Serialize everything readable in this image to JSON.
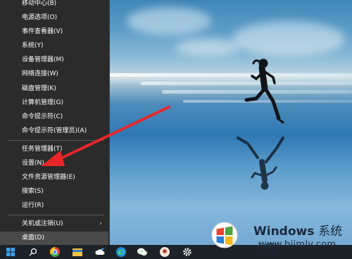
{
  "context_menu": {
    "items_group1": [
      {
        "label": "移动中心(B)"
      },
      {
        "label": "电源选项(O)"
      },
      {
        "label": "事件查看器(V)"
      },
      {
        "label": "系统(Y)"
      },
      {
        "label": "设备管理器(M)"
      },
      {
        "label": "网络连接(W)"
      },
      {
        "label": "磁盘管理(K)"
      },
      {
        "label": "计算机管理(G)"
      },
      {
        "label": "命令提示符(C)"
      },
      {
        "label": "命令提示符(管理员)(A)"
      }
    ],
    "items_group2": [
      {
        "label": "任务管理器(T)"
      },
      {
        "label": "设置(N)"
      },
      {
        "label": "文件资源管理器(E)"
      },
      {
        "label": "搜索(S)"
      },
      {
        "label": "运行(R)"
      }
    ],
    "items_group3": [
      {
        "label": "关机或注销(U)",
        "has_submenu": true
      },
      {
        "label": "桌面(D)",
        "highlighted": true
      }
    ],
    "submenu_arrow": "›"
  },
  "watermark": {
    "brand": "Windows",
    "brand_cn": "系统之家",
    "url": "www.bjjmlv.com"
  },
  "colors": {
    "menu_bg": "#2b2b2b",
    "highlight_bg": "#4a4a4a",
    "annotation_arrow": "#e8262a",
    "taskbar_bg": "#1d2229"
  },
  "icons": {
    "start": "windows-logo-icon",
    "search": "search-icon",
    "taskbar_apps": [
      "chrome-icon",
      "file-explorer-icon",
      "weather-icon",
      "edge-icon",
      "wechat-icon",
      "store-icon",
      "avatar-app-icon",
      "settings-gear-icon"
    ]
  }
}
